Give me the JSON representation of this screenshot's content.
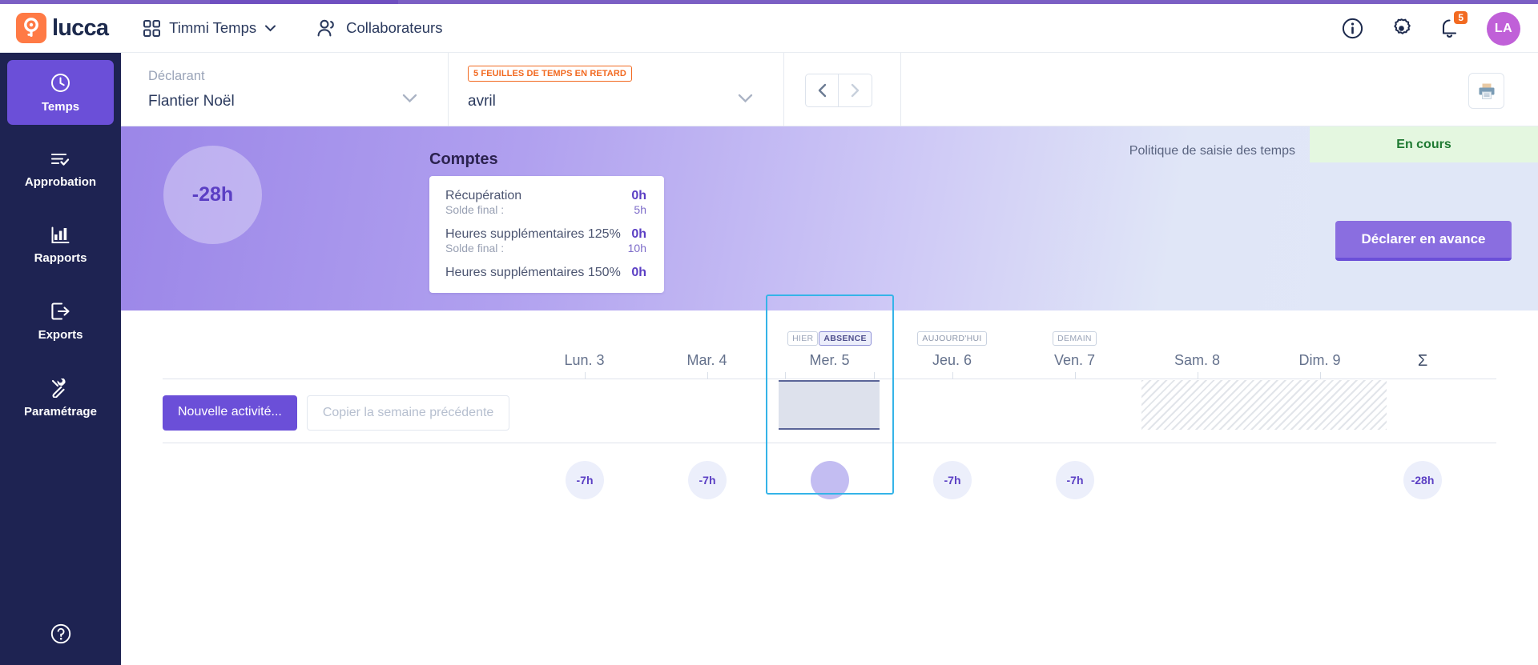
{
  "header": {
    "logo_text": "lucca",
    "nav": [
      {
        "label": "Timmi Temps",
        "icon": "grid-icon",
        "has_chevron": true
      },
      {
        "label": "Collaborateurs",
        "icon": "people-icon",
        "has_chevron": false
      }
    ],
    "icons": [
      {
        "name": "info-icon"
      },
      {
        "name": "gear-icon"
      },
      {
        "name": "bell-icon",
        "badge": "5"
      }
    ],
    "avatar_initials": "LA"
  },
  "sidebar": {
    "items": [
      {
        "label": "Temps",
        "icon": "clock-icon",
        "active": true
      },
      {
        "label": "Approbation",
        "icon": "list-check-icon",
        "active": false
      },
      {
        "label": "Rapports",
        "icon": "bar-chart-icon",
        "active": false
      },
      {
        "label": "Exports",
        "icon": "export-icon",
        "active": false
      },
      {
        "label": "Paramétrage",
        "icon": "wrench-icon",
        "active": false
      }
    ],
    "help_icon": "help-circle-icon"
  },
  "filterbar": {
    "declarant_label": "Déclarant",
    "declarant_value": "Flantier Noël",
    "late_badge": "5 FEUILLES DE TEMPS EN RETARD",
    "month_value": "avril",
    "prev_icon": "chevron-left-icon",
    "next_icon": "chevron-right-icon",
    "print_icon": "printer-icon"
  },
  "banner": {
    "donut_value": "-28h",
    "comptes_title": "Comptes",
    "accounts": [
      {
        "label": "Récupération",
        "value": "0h",
        "sub_label": "Solde final :",
        "sub_value": "5h"
      },
      {
        "label": "Heures supplémentaires 125%",
        "value": "0h",
        "sub_label": "Solde final :",
        "sub_value": "10h"
      },
      {
        "label": "Heures supplémentaires 150%",
        "value": "0h",
        "sub_label": "",
        "sub_value": ""
      }
    ],
    "policy_link": "Politique de saisie des temps",
    "status": "En cours",
    "declare_button": "Déclarer en avance"
  },
  "calendar": {
    "days": [
      {
        "name": "Lun. 3",
        "badges": [],
        "total": "-7h",
        "weekend": false,
        "selected": false,
        "has_absence": false
      },
      {
        "name": "Mar. 4",
        "badges": [],
        "total": "-7h",
        "weekend": false,
        "selected": false,
        "has_absence": false
      },
      {
        "name": "Mer. 5",
        "badges": [
          "HIER",
          "ABSENCE"
        ],
        "total": "",
        "weekend": false,
        "selected": true,
        "has_absence": true
      },
      {
        "name": "Jeu. 6",
        "badges": [
          "AUJOURD'HUI"
        ],
        "total": "-7h",
        "weekend": false,
        "selected": false,
        "has_absence": false
      },
      {
        "name": "Ven. 7",
        "badges": [
          "DEMAIN"
        ],
        "total": "-7h",
        "weekend": false,
        "selected": false,
        "has_absence": false
      },
      {
        "name": "Sam. 8",
        "badges": [],
        "total": "",
        "weekend": true,
        "selected": false,
        "has_absence": false
      },
      {
        "name": "Dim. 9",
        "badges": [],
        "total": "",
        "weekend": true,
        "selected": false,
        "has_absence": false
      }
    ],
    "sigma_symbol": "Σ",
    "sigma_total": "-28h",
    "new_activity_button": "Nouvelle activité...",
    "copy_week_button": "Copier la semaine précédente"
  },
  "colors": {
    "brand_orange": "#ff7a45",
    "brand_purple": "#6b4fd8",
    "sidebar_navy": "#1e2352",
    "status_green": "#1f7a32",
    "selection_blue": "#35b4e8"
  }
}
